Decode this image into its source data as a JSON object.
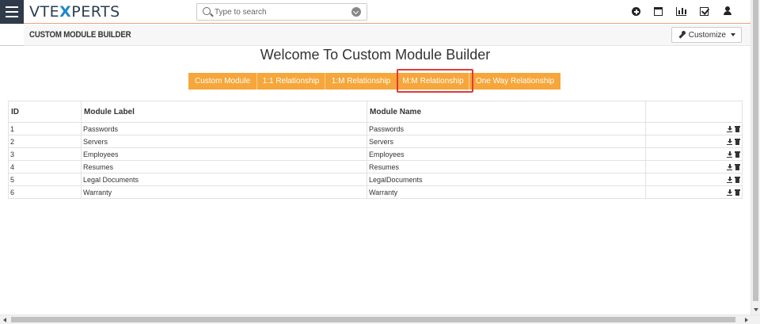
{
  "header": {
    "logo_prefix": "VTE",
    "logo_x": "X",
    "logo_suffix": "PERTS",
    "search_placeholder": "Type to search",
    "icons": [
      "plus-circle-icon",
      "calendar-icon",
      "bar-chart-icon",
      "checkbox-icon",
      "user-icon"
    ]
  },
  "subheader": {
    "title": "CUSTOM MODULE BUILDER",
    "customize_label": "Customize"
  },
  "main": {
    "welcome": "Welcome To Custom Module Builder",
    "tabs": [
      {
        "label": "Custom Module"
      },
      {
        "label": "1:1 Relationship"
      },
      {
        "label": "1:M Relationship"
      },
      {
        "label": "M:M Relationship",
        "highlighted": true
      },
      {
        "label": "One Way Relationship"
      }
    ],
    "tab_color": "#f6a63a",
    "highlight_color": "#e03a3a"
  },
  "table": {
    "columns": [
      "ID",
      "Module Label",
      "Module Name",
      ""
    ],
    "rows": [
      {
        "id": "1",
        "label": "Passwords",
        "name": "Passwords"
      },
      {
        "id": "2",
        "label": "Servers",
        "name": "Servers"
      },
      {
        "id": "3",
        "label": "Employees",
        "name": "Employees"
      },
      {
        "id": "4",
        "label": "Resumes",
        "name": "Resumes"
      },
      {
        "id": "5",
        "label": "Legal Documents",
        "name": "LegalDocuments"
      },
      {
        "id": "6",
        "label": "Warranty",
        "name": "Warranty"
      }
    ],
    "row_actions": [
      "download-icon",
      "trash-icon"
    ]
  }
}
